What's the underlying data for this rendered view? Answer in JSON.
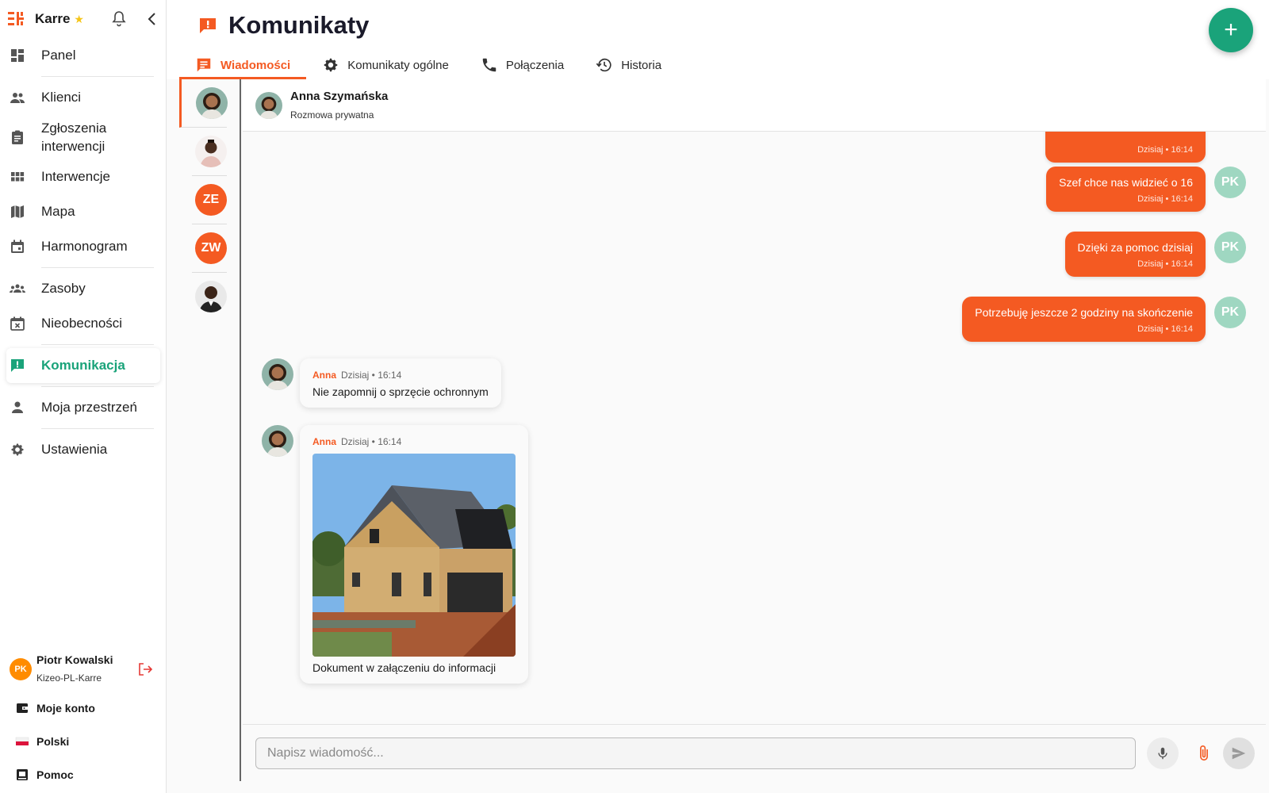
{
  "app": {
    "name": "Karre",
    "accent": "#f45a22",
    "active_color": "#1aa37a"
  },
  "sidebar": {
    "items": [
      {
        "label": "Panel",
        "icon": "dashboard-icon"
      },
      {
        "label": "Klienci",
        "icon": "people-icon"
      },
      {
        "label": "Zgłoszenia interwencji",
        "icon": "clipboard-icon"
      },
      {
        "label": "Interwencje",
        "icon": "grid-icon"
      },
      {
        "label": "Mapa",
        "icon": "map-icon"
      },
      {
        "label": "Harmonogram",
        "icon": "calendar-icon"
      },
      {
        "label": "Zasoby",
        "icon": "group-icon"
      },
      {
        "label": "Nieobecności",
        "icon": "calendar-x-icon"
      },
      {
        "label": "Komunikacja",
        "icon": "alert-chat-icon"
      },
      {
        "label": "Moja przestrzeń",
        "icon": "person-icon"
      },
      {
        "label": "Ustawienia",
        "icon": "gear-icon"
      }
    ]
  },
  "user": {
    "name": "Piotr Kowalski",
    "org": "Kizeo-PL-Karre",
    "initials": "PK"
  },
  "bottom_links": [
    {
      "label": "Moje konto",
      "icon": "wallet-icon"
    },
    {
      "label": "Polski",
      "icon": "poland-flag-icon"
    },
    {
      "label": "Pomoc",
      "icon": "help-icon"
    }
  ],
  "page": {
    "title": "Komunikaty",
    "fab": "+"
  },
  "tabs": [
    {
      "label": "Wiadomości",
      "icon": "chat-icon"
    },
    {
      "label": "Komunikaty ogólne",
      "icon": "gear-icon"
    },
    {
      "label": "Połączenia",
      "icon": "phone-icon"
    },
    {
      "label": "Historia",
      "icon": "history-icon"
    }
  ],
  "conversations": [
    {
      "initials": "",
      "color": "#8fb3a8"
    },
    {
      "initials": "",
      "color": "#e8d0cc"
    },
    {
      "initials": "ZE",
      "color": "#f45a22"
    },
    {
      "initials": "ZW",
      "color": "#f45a22"
    },
    {
      "initials": "",
      "color": "#6b5a4e"
    }
  ],
  "chat": {
    "contact_name": "Anna Szymańska",
    "contact_sub": "Rozmowa prywatna",
    "messages_out": [
      {
        "text": "",
        "time": "Dzisiaj • 16:14"
      },
      {
        "text": "Szef chce nas widzieć o 16",
        "time": "Dzisiaj • 16:14",
        "initials": "PK"
      },
      {
        "text": "Dzięki za pomoc dzisiaj",
        "time": "Dzisiaj • 16:14",
        "initials": "PK"
      },
      {
        "text": "Potrzebuję jeszcze 2 godziny na skończenie",
        "time": "Dzisiaj • 16:14",
        "initials": "PK"
      }
    ],
    "messages_in": [
      {
        "sender": "Anna",
        "time": "Dzisiaj • 16:14",
        "text": "Nie zapomnij o sprzęcie ochronnym"
      },
      {
        "sender": "Anna",
        "time": "Dzisiaj • 16:14",
        "text": "Dokument w załączeniu do informacji"
      }
    ],
    "composer_placeholder": "Napisz wiadomość..."
  }
}
